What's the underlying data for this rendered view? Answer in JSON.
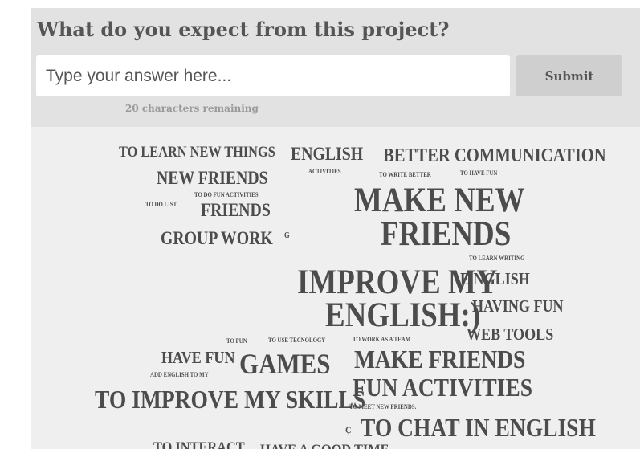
{
  "question": "What do you expect from this project?",
  "input": {
    "placeholder": "Type your answer here...",
    "value": ""
  },
  "submit_label": "Submit",
  "remaining_text": "20 characters remaining",
  "words": {
    "w01": "TO LEARN NEW THINGS",
    "w02": "ENGLISH",
    "w03": "BETTER COMMUNICATION",
    "w04": "NEW FRIENDS",
    "w05": "ACTIVITIES",
    "w06": "TO WRITE BETTER",
    "w07": "TO HAVE FUN",
    "w08": "TO DO FUN ACTIVITIES",
    "w09": "TO DO LIST",
    "w10": "FRIENDS",
    "w11": "MAKE NEW",
    "w12": "FRIENDS",
    "w13": "GROUP WORK",
    "w14": "G",
    "w15": "TO LEARN WRITING",
    "w16": "IMPROVE MY",
    "w17": "E NGLISH",
    "w18": "ENGLISH:)",
    "w19": "HAVING FUN",
    "w20": "WEB TOOLS",
    "w21": "TO FUN",
    "w22": "TO USE TECNOLOGY",
    "w23": "TO WORK AS A TEAM",
    "w24": "HAVE FUN",
    "w25": "GAMES",
    "w26": "MAKE FRIENDS",
    "w27": "ADD ENGLISH TO MY",
    "w28": "FUN ACTIVITIES",
    "w29": "TO IMPROVE MY SKILLS",
    "w30": "TO MEET NEW FRIENDS.",
    "w31": "Ç",
    "w32": "TO CHAT IN ENGLISH",
    "w33": "TO INTERACT",
    "w34": "HAVE A GOOD TIME"
  }
}
